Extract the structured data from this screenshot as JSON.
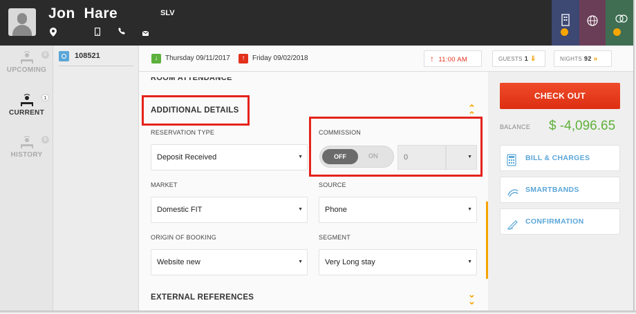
{
  "header": {
    "guest_name": "Jon  Hare",
    "guest_code": "SLV",
    "icons": [
      "location-pin-icon",
      "mobile-phone-icon",
      "phone-icon",
      "email-icon"
    ],
    "right_tabs": [
      {
        "name": "building-tab",
        "color": "#3d4873"
      },
      {
        "name": "globe-tab",
        "color": "#6b3e57"
      },
      {
        "name": "rings-tab",
        "color": "#3f6e52"
      }
    ]
  },
  "leftnav": {
    "items": [
      {
        "label": "UPCOMING",
        "badge": "0",
        "icon": "upcoming-bed-icon"
      },
      {
        "label": "CURRENT",
        "badge": "1",
        "icon": "current-bed-icon"
      },
      {
        "label": "HISTORY",
        "badge": "0",
        "icon": "history-bed-icon"
      }
    ]
  },
  "reservation": {
    "id": "108521"
  },
  "datebar": {
    "arrival": "Thursday 09/11/2017",
    "departure": "Friday 09/02/2018",
    "arrival_time": "11:00 AM",
    "guests_label": "GUESTS",
    "guests_value": "1",
    "nights_label": "NIGHTS",
    "nights_value": "92"
  },
  "form": {
    "clipped_section": "ROOM ATTENDANCE",
    "section_title": "ADDITIONAL DETAILS",
    "reservation_type_label": "RESERVATION TYPE",
    "reservation_type_value": "Deposit Received",
    "commission_label": "COMMISSION",
    "toggle_off": "OFF",
    "toggle_on": "ON",
    "commission_value": "0",
    "market_label": "MARKET",
    "market_value": "Domestic FIT",
    "source_label": "SOURCE",
    "source_value": "Phone",
    "origin_label": "ORIGIN OF BOOKING",
    "origin_value": "Website new",
    "segment_label": "SEGMENT",
    "segment_value": "Very Long stay",
    "external_refs": "EXTERNAL REFERENCES"
  },
  "actions": {
    "checkout": "CHECK OUT",
    "balance_label": "BALANCE",
    "balance_value": "$ -4,096.65",
    "bill": "BILL & CHARGES",
    "smartbands": "SMARTBANDS",
    "confirmation": "CONFIRMATION"
  },
  "colors": {
    "accent_orange": "#f5a300",
    "checkout_red": "#e23a1c",
    "balance_green": "#5fb03b",
    "link_blue": "#5aa6d8",
    "highlight_red": "#e4221b"
  }
}
